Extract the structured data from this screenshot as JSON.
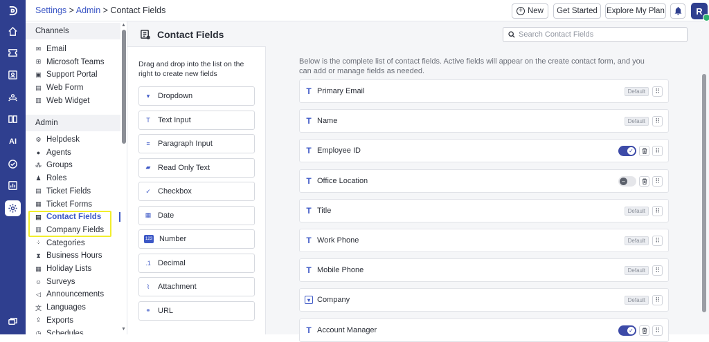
{
  "breadcrumb": {
    "settings": "Settings",
    "sep1": " > ",
    "admin": "Admin",
    "sep2": " > ",
    "current": "Contact Fields"
  },
  "topbar": {
    "new_label": "New",
    "get_started_label": "Get Started",
    "explore_label": "Explore My Plan",
    "avatar_initial": "R"
  },
  "rail": {
    "ai_label": "AI"
  },
  "menu": {
    "channels_header": "Channels",
    "channels": [
      {
        "label": "Email",
        "icon": "mail-icon"
      },
      {
        "label": "Microsoft Teams",
        "icon": "teams-icon"
      },
      {
        "label": "Support Portal",
        "icon": "portal-icon"
      },
      {
        "label": "Web Form",
        "icon": "form-icon"
      },
      {
        "label": "Web Widget",
        "icon": "widget-icon"
      }
    ],
    "admin_header": "Admin",
    "admin": [
      {
        "label": "Helpdesk",
        "icon": "helpdesk-icon"
      },
      {
        "label": "Agents",
        "icon": "agent-icon"
      },
      {
        "label": "Groups",
        "icon": "groups-icon"
      },
      {
        "label": "Roles",
        "icon": "roles-icon"
      },
      {
        "label": "Ticket Fields",
        "icon": "ticket-fields-icon"
      },
      {
        "label": "Ticket Forms",
        "icon": "ticket-forms-icon"
      },
      {
        "label": "Contact Fields",
        "icon": "contact-fields-icon"
      },
      {
        "label": "Company Fields",
        "icon": "company-fields-icon"
      },
      {
        "label": "Categories",
        "icon": "categories-icon"
      },
      {
        "label": "Business Hours",
        "icon": "hourglass-icon"
      },
      {
        "label": "Holiday Lists",
        "icon": "calendar-icon"
      },
      {
        "label": "Surveys",
        "icon": "survey-icon"
      },
      {
        "label": "Announcements",
        "icon": "megaphone-icon"
      },
      {
        "label": "Languages",
        "icon": "language-icon"
      },
      {
        "label": "Exports",
        "icon": "export-icon"
      },
      {
        "label": "Schedules",
        "icon": "schedule-icon"
      }
    ]
  },
  "page": {
    "title": "Contact Fields",
    "search_placeholder": "Search Contact Fields",
    "palette_hint": "Drag and drop into the list on the right to create new fields",
    "palette": [
      {
        "label": "Dropdown",
        "glyph": "▾"
      },
      {
        "label": "Text Input",
        "glyph": "T"
      },
      {
        "label": "Paragraph Input",
        "glyph": "≡"
      },
      {
        "label": "Read Only Text",
        "glyph": "▰"
      },
      {
        "label": "Checkbox",
        "glyph": "✓"
      },
      {
        "label": "Date",
        "glyph": "▦"
      },
      {
        "label": "Number",
        "glyph": "123"
      },
      {
        "label": "Decimal",
        "glyph": ".1"
      },
      {
        "label": "Attachment",
        "glyph": "⌇"
      },
      {
        "label": "URL",
        "glyph": "⚭"
      }
    ],
    "description": "Below is the complete list of contact fields. Active fields will appear on the create contact form, and you can add or manage fields as needed.",
    "fields": [
      {
        "label": "Primary Email",
        "type": "text",
        "default": true,
        "badge": "Default"
      },
      {
        "label": "Name",
        "type": "text",
        "default": true,
        "badge": "Default"
      },
      {
        "label": "Employee ID",
        "type": "text",
        "default": false,
        "active": true
      },
      {
        "label": "Office Location",
        "type": "text",
        "default": false,
        "active": false
      },
      {
        "label": "Title",
        "type": "text",
        "default": true,
        "badge": "Default"
      },
      {
        "label": "Work Phone",
        "type": "text",
        "default": true,
        "badge": "Default"
      },
      {
        "label": "Mobile Phone",
        "type": "text",
        "default": true,
        "badge": "Default"
      },
      {
        "label": "Company",
        "type": "dropdown",
        "default": true,
        "badge": "Default"
      },
      {
        "label": "Account Manager",
        "type": "text",
        "default": false,
        "active": true
      }
    ]
  },
  "colors": {
    "rail": "#2f3f8f",
    "accent": "#3d58c6",
    "highlight": "#f2ee2c",
    "toggle_on": "#3d4ba8"
  }
}
